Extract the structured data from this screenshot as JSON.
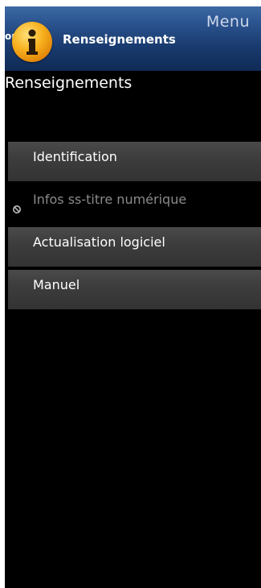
{
  "header": {
    "menu_label": "Menu",
    "cut_text": "or",
    "title": "Renseignements",
    "badge_icon": "info-icon",
    "badge_glyph": "i"
  },
  "page": {
    "title": "Renseignements"
  },
  "menu_items": [
    {
      "label": "Identification",
      "enabled": true
    },
    {
      "label": "Infos ss-titre numérique",
      "enabled": false,
      "icon": "disabled-icon"
    },
    {
      "label": "Actualisation logiciel",
      "enabled": true
    },
    {
      "label": "Manuel",
      "enabled": true
    }
  ],
  "colors": {
    "header_gradient_top": "#3d6aa4",
    "header_gradient_bottom": "#0f2a55",
    "badge": "#f7b11e",
    "item_bg": "#3d3d3d",
    "disabled_text": "#8a8a8a"
  }
}
